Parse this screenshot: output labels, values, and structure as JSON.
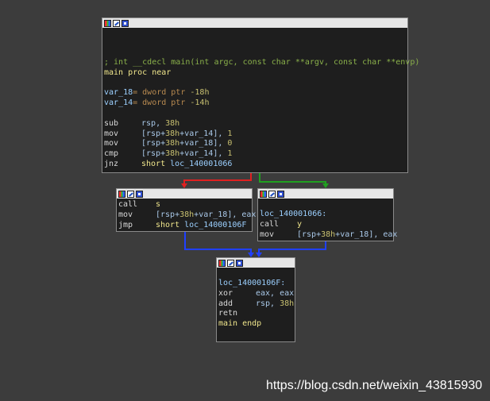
{
  "block_main": {
    "comment": "; int __cdecl main(int argc, const char **argv, const char **envp)",
    "proc_name": "main",
    "proc_kw": "proc near",
    "var18_name": "var_18",
    "var18_type": "= dword ptr",
    "var18_off": "-18h",
    "var14_name": "var_14",
    "var14_type": "= dword ptr",
    "var14_off": "-14h",
    "i1_mn": "sub",
    "i1_reg": "rsp",
    "i1_sep": ", ",
    "i1_imm": "38h",
    "i2_mn": "mov",
    "i2_pre": "[rsp+",
    "i2_disp": "38h",
    "i2_mid": "+var_14], ",
    "i2_imm": "1",
    "i3_mn": "mov",
    "i3_pre": "[rsp+",
    "i3_disp": "38h",
    "i3_mid": "+var_18], ",
    "i3_imm": "0",
    "i4_mn": "cmp",
    "i4_pre": "[rsp+",
    "i4_disp": "38h",
    "i4_mid": "+var_14], ",
    "i4_imm": "1",
    "i5_mn": "jnz",
    "i5_kw": "short",
    "i5_target": "loc_140001066"
  },
  "block_left": {
    "i1_mn": "call",
    "i1_target": "s",
    "i2_mn": "mov",
    "i2_pre": "[rsp+",
    "i2_disp": "38h",
    "i2_mid": "+var_18], eax",
    "i3_mn": "jmp",
    "i3_kw": "short",
    "i3_target": "loc_14000106F"
  },
  "block_right": {
    "label": "loc_140001066:",
    "i1_mn": "call",
    "i1_target": "y",
    "i2_mn": "mov",
    "i2_pre": "[rsp+",
    "i2_disp": "38h",
    "i2_mid": "+var_18], eax"
  },
  "block_bottom": {
    "label": "loc_14000106F:",
    "i1_mn": "xor",
    "i1_ops": "eax, eax",
    "i2_mn": "add",
    "i2_reg": "rsp, ",
    "i2_imm": "38h",
    "i3_mn": "retn",
    "end_name": "main",
    "end_kw": "endp"
  },
  "edge_colors": {
    "false_branch": "#e02020",
    "true_branch": "#20a020",
    "unconditional": "#2040ff"
  },
  "watermark": "https://blog.csdn.net/weixin_43815930"
}
